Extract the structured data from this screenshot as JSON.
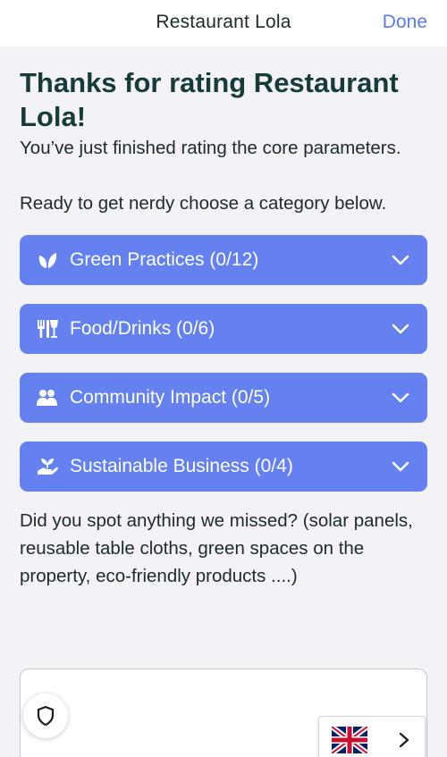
{
  "header": {
    "title": "Restaurant Lola",
    "done_label": "Done"
  },
  "main": {
    "heading": "Thanks for rating Restaurant Lola!",
    "intro": "You’ve just finished rating the core parameters.",
    "prompt": "Ready to get nerdy choose a category below.",
    "categories": [
      {
        "label": "Green Practices (0/12)",
        "icon": "leaf-icon"
      },
      {
        "label": "Food/Drinks (0/6)",
        "icon": "food-drink-icon"
      },
      {
        "label": "Community Impact (0/5)",
        "icon": "people-icon"
      },
      {
        "label": "Sustainable Business (0/4)",
        "icon": "hand-plant-icon"
      }
    ],
    "question": "Did you spot anything we missed? (solar panels, reusable table cloths, green spaces on the property, eco-friendly products ....)",
    "feedback_value": ""
  },
  "overlays": {
    "privacy_icon": "shield-icon",
    "language_flag": "uk-flag-icon",
    "language_chevron": "chevron-right-icon"
  },
  "colors": {
    "accent": "#6581f0",
    "done": "#5b7be9",
    "heading": "#163b38",
    "background": "#f2f2f7"
  }
}
